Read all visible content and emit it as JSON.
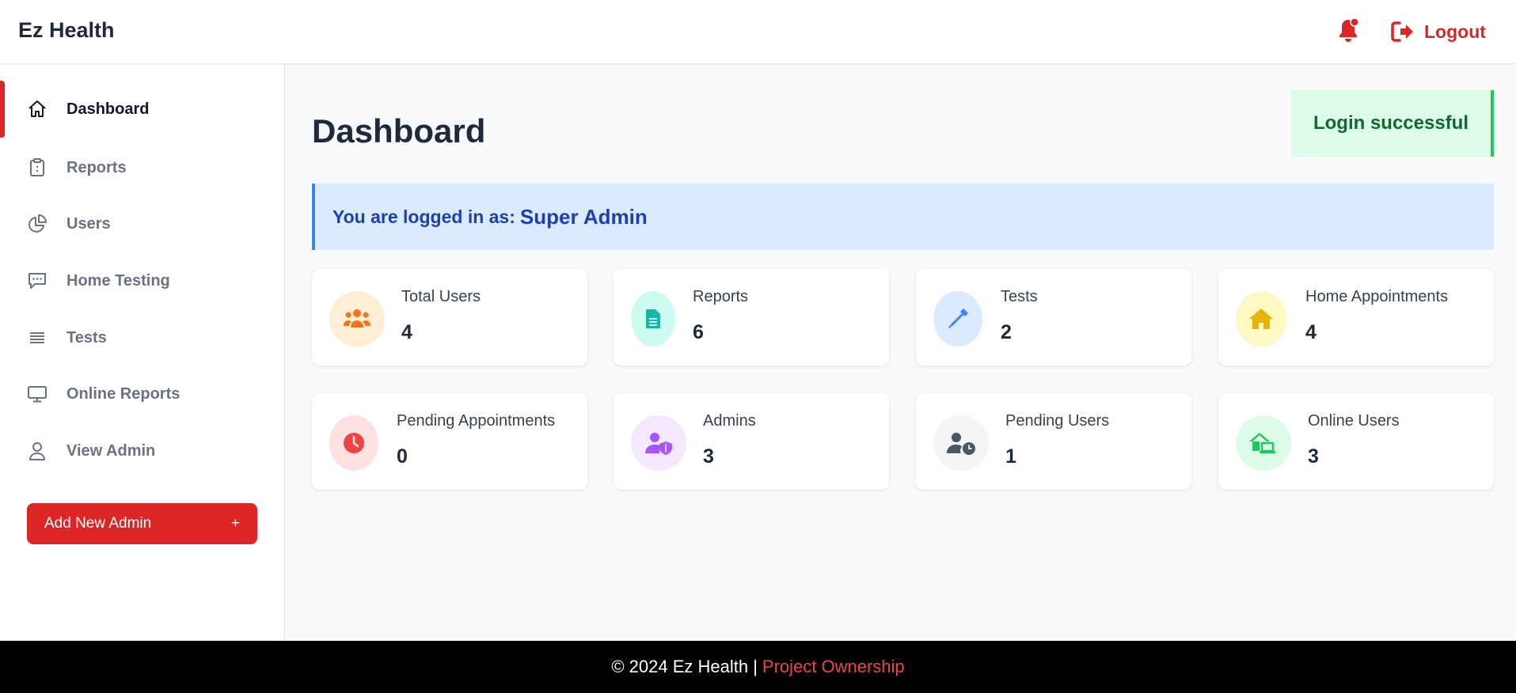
{
  "header": {
    "brand": "Ez Health",
    "notification_icon": "bell-icon",
    "logout_label": "Logout",
    "logout_icon": "sign-out-icon"
  },
  "colors": {
    "accent": "#dc2626",
    "success_bg": "#dcfce7",
    "info_bg": "#dbeafe",
    "footer_bg": "#000000"
  },
  "sidebar": {
    "items": [
      {
        "label": "Dashboard",
        "icon": "home-icon",
        "active": true
      },
      {
        "label": "Reports",
        "icon": "clipboard-icon"
      },
      {
        "label": "Users",
        "icon": "pie-chart-icon"
      },
      {
        "label": "Home Testing",
        "icon": "chat-icon"
      },
      {
        "label": "Tests",
        "icon": "list-icon"
      },
      {
        "label": "Online Reports",
        "icon": "monitor-icon"
      },
      {
        "label": "View Admin",
        "icon": "user-icon"
      }
    ],
    "add_admin_label": "Add New Admin",
    "add_admin_symbol": "+"
  },
  "main": {
    "title": "Dashboard",
    "toast": "Login successful",
    "role_prefix": "You are logged in as:",
    "role": "Super Admin",
    "stats": [
      {
        "label": "Total Users",
        "value": "4",
        "icon": "users-icon",
        "color": "#f97316",
        "bg": "#ffedd5"
      },
      {
        "label": "Reports",
        "value": "6",
        "icon": "file-icon",
        "color": "#14b8a6",
        "bg": "#ccfbf1"
      },
      {
        "label": "Tests",
        "value": "2",
        "icon": "eyedropper-icon",
        "color": "#3b82f6",
        "bg": "#dbeafe"
      },
      {
        "label": "Home Appointments",
        "value": "4",
        "icon": "house-icon",
        "color": "#eab308",
        "bg": "#fef9c3"
      },
      {
        "label": "Pending Appointments",
        "value": "0",
        "icon": "clock-icon",
        "color": "#ef4444",
        "bg": "#fee2e2"
      },
      {
        "label": "Admins",
        "value": "3",
        "icon": "user-shield-icon",
        "color": "#a855f7",
        "bg": "#f3e8ff"
      },
      {
        "label": "Pending Users",
        "value": "1",
        "icon": "user-clock-icon",
        "color": "#4b5563",
        "bg": "#f3f4f6"
      },
      {
        "label": "Online Users",
        "value": "3",
        "icon": "house-laptop-icon",
        "color": "#22c55e",
        "bg": "#dcfce7"
      }
    ]
  },
  "footer": {
    "copyright": "© 2024 Ez Health |",
    "link": "Project Ownership"
  }
}
